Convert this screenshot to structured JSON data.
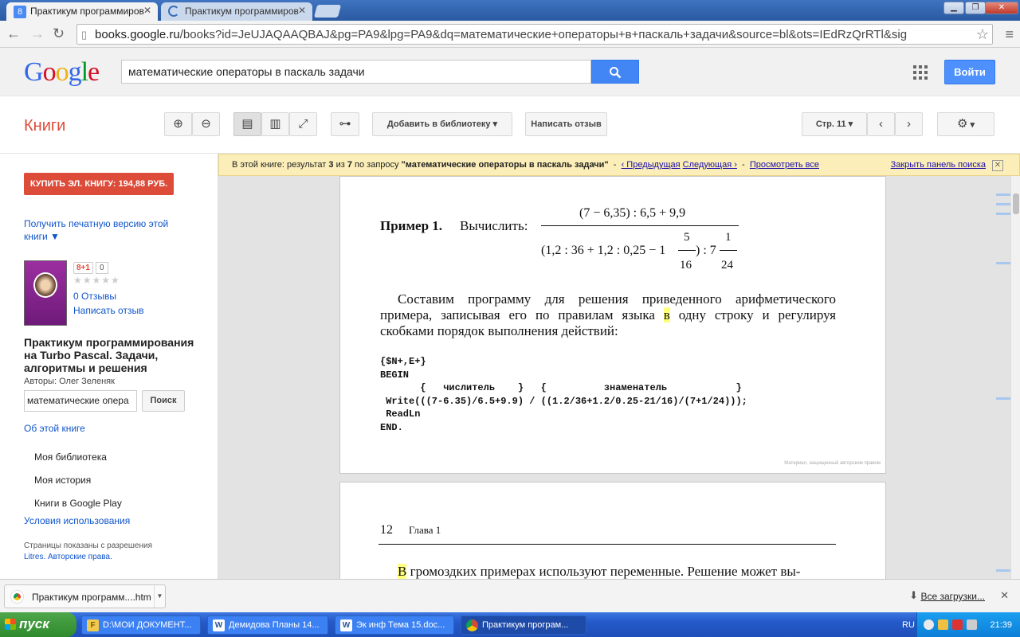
{
  "browser": {
    "tabs": [
      {
        "title": "Практикум программиров",
        "icon": "8"
      },
      {
        "title": "Практикум программиров",
        "icon": "C"
      }
    ],
    "url_host": "books.google.ru",
    "url_rest": "/books?id=JeUJAQAAQBAJ&pg=PA9&lpg=PA9&dq=математические+операторы+в+паскаль+задачи&source=bl&ots=IEdRzQrRTl&sig"
  },
  "header": {
    "logo": [
      "G",
      "o",
      "o",
      "g",
      "l",
      "e"
    ],
    "search_value": "математические операторы в паскаль задачи",
    "signin_label": "Войти"
  },
  "books_bar": {
    "title": "Книги",
    "add_to_library": "Добавить в библиотеку",
    "write_review": "Написать отзыв",
    "page_label": "Стр. 11"
  },
  "notice": {
    "prefix": "В этой книге: результат",
    "current": "3",
    "of": "из",
    "total": "7",
    "query_prefix": "по запросу",
    "query": "\"математические операторы в паскаль задачи\"",
    "sep": "-",
    "prev": "‹ Предыдущая",
    "next": "Следующая ›",
    "view_all": "Просмотреть все",
    "close_panel": "Закрыть панель поиска"
  },
  "sidebar": {
    "buy_label": "КУПИТЬ ЭЛ. КНИГУ: 194,88 РУБ.",
    "print_version": "Получить печатную версию этой книги ▼",
    "gplus": "8+1",
    "gplus_count": "0",
    "reviews": "0 Отзывы",
    "write_review": "Написать отзыв",
    "book_title": "Практикум программирования на Turbo Pascal. Задачи, алгоритмы и решения",
    "authors": "Авторы: Олег Зеленяк",
    "search_value": "математические опера",
    "search_button": "Поиск",
    "about": "Об этой книге",
    "links": [
      "Моя библиотека",
      "Моя история",
      "Книги в Google Play"
    ],
    "terms": "Условия использования",
    "permission": "Страницы показаны с разрешения",
    "permission_link": "Litres. Авторские права."
  },
  "page1": {
    "example": "Пример 1.",
    "compute": "Вычислить:",
    "numerator": "(7 − 6,35) : 6,5 + 9,9",
    "denominator_a": "(1,2 : 36 + 1,2 : 0,25 − 1",
    "frac1_num": "5",
    "frac1_den": "16",
    "denominator_b": ") : 7",
    "frac2_num": "1",
    "frac2_den": "24",
    "paragraph_a": "Составим программу для решения приведенного арифметического примера, записывая его по правилам языка ",
    "paragraph_hl": "в",
    "paragraph_b": " одну строку и регулируя скобками порядок выполнения действий:",
    "code": "{$N+,E+}\nBEGIN\n       {   числитель    }   {          знаменатель            }\n Write(((7-6.35)/6.5+9.9) / ((1.2/36+1.2/0.25-21/16)/(7+1/24)));\n ReadLn\nEND.",
    "copyright": "Материал, защищенный авторским правом"
  },
  "page2": {
    "page_number": "12",
    "chapter": "Глава 1",
    "text_hl": "В",
    "text": " громоздких примерах используют переменные. Решение может вы-"
  },
  "downloads": {
    "file": "Практикум программ....htm",
    "all": "Все загрузки..."
  },
  "taskbar": {
    "start": "пуск",
    "items": [
      {
        "label": "D:\\МОИ ДОКУМЕНТ...",
        "icon": "F"
      },
      {
        "label": "Демидова Планы 14...",
        "icon": "W"
      },
      {
        "label": "Эк инф Тема 15.doc...",
        "icon": "W"
      },
      {
        "label": "Практикум програм...",
        "icon": "C"
      }
    ],
    "lang": "RU",
    "time": "21:39"
  }
}
